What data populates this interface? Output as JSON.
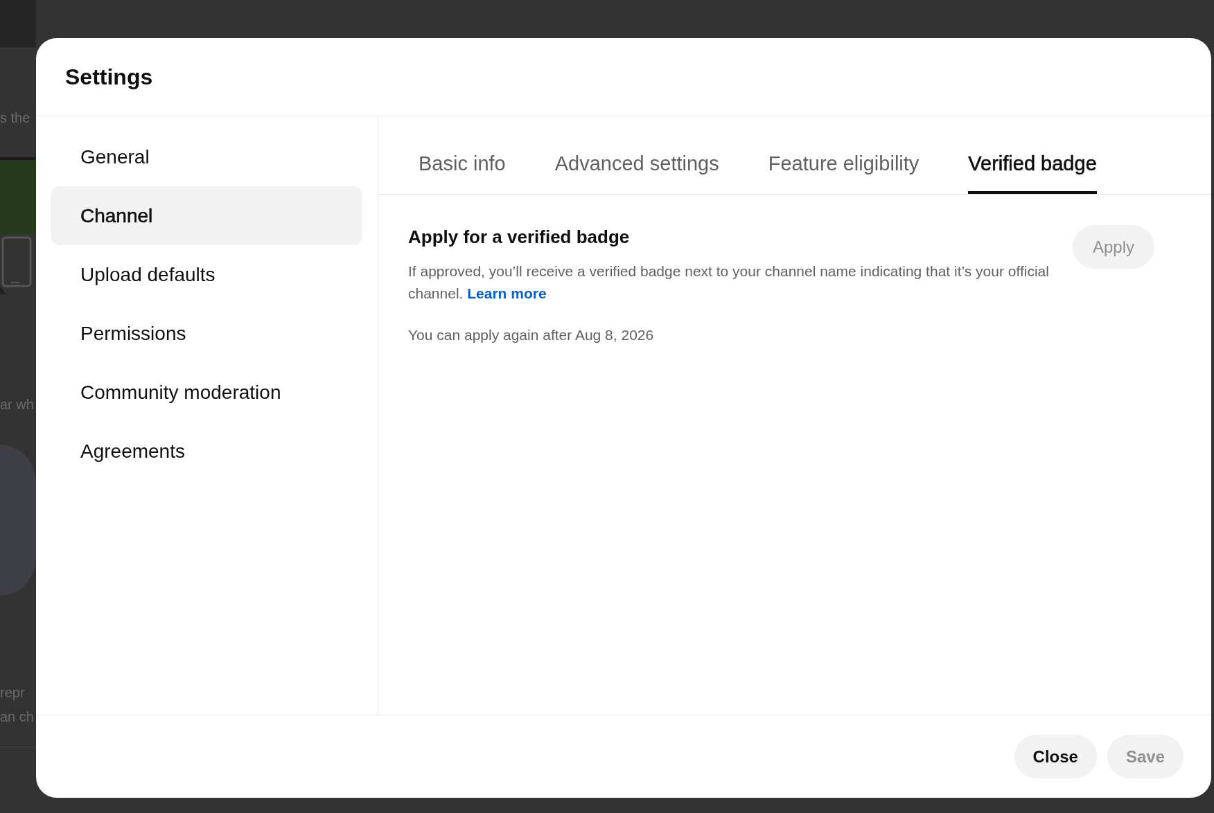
{
  "background_page": {
    "texts": [
      "s the",
      "ar wh",
      "repr",
      "an ch"
    ]
  },
  "dialog": {
    "title": "Settings",
    "sidebar": {
      "items": [
        {
          "label": "General",
          "selected": false
        },
        {
          "label": "Channel",
          "selected": true
        },
        {
          "label": "Upload defaults",
          "selected": false
        },
        {
          "label": "Permissions",
          "selected": false
        },
        {
          "label": "Community moderation",
          "selected": false
        },
        {
          "label": "Agreements",
          "selected": false
        }
      ]
    },
    "tabs": [
      {
        "label": "Basic info",
        "selected": false
      },
      {
        "label": "Advanced settings",
        "selected": false
      },
      {
        "label": "Feature eligibility",
        "selected": false
      },
      {
        "label": "Verified badge",
        "selected": true
      }
    ],
    "section": {
      "title": "Apply for a verified badge",
      "description": "If approved, you’ll receive a verified badge next to your channel name indicating that it’s your official channel.",
      "link": "Learn more",
      "note": "You can apply again after Aug 8, 2026",
      "apply_button": {
        "label": "Apply",
        "disabled": true
      }
    },
    "footer_buttons": [
      {
        "label": "Close",
        "disabled": false
      },
      {
        "label": "Save",
        "disabled": true
      }
    ]
  }
}
